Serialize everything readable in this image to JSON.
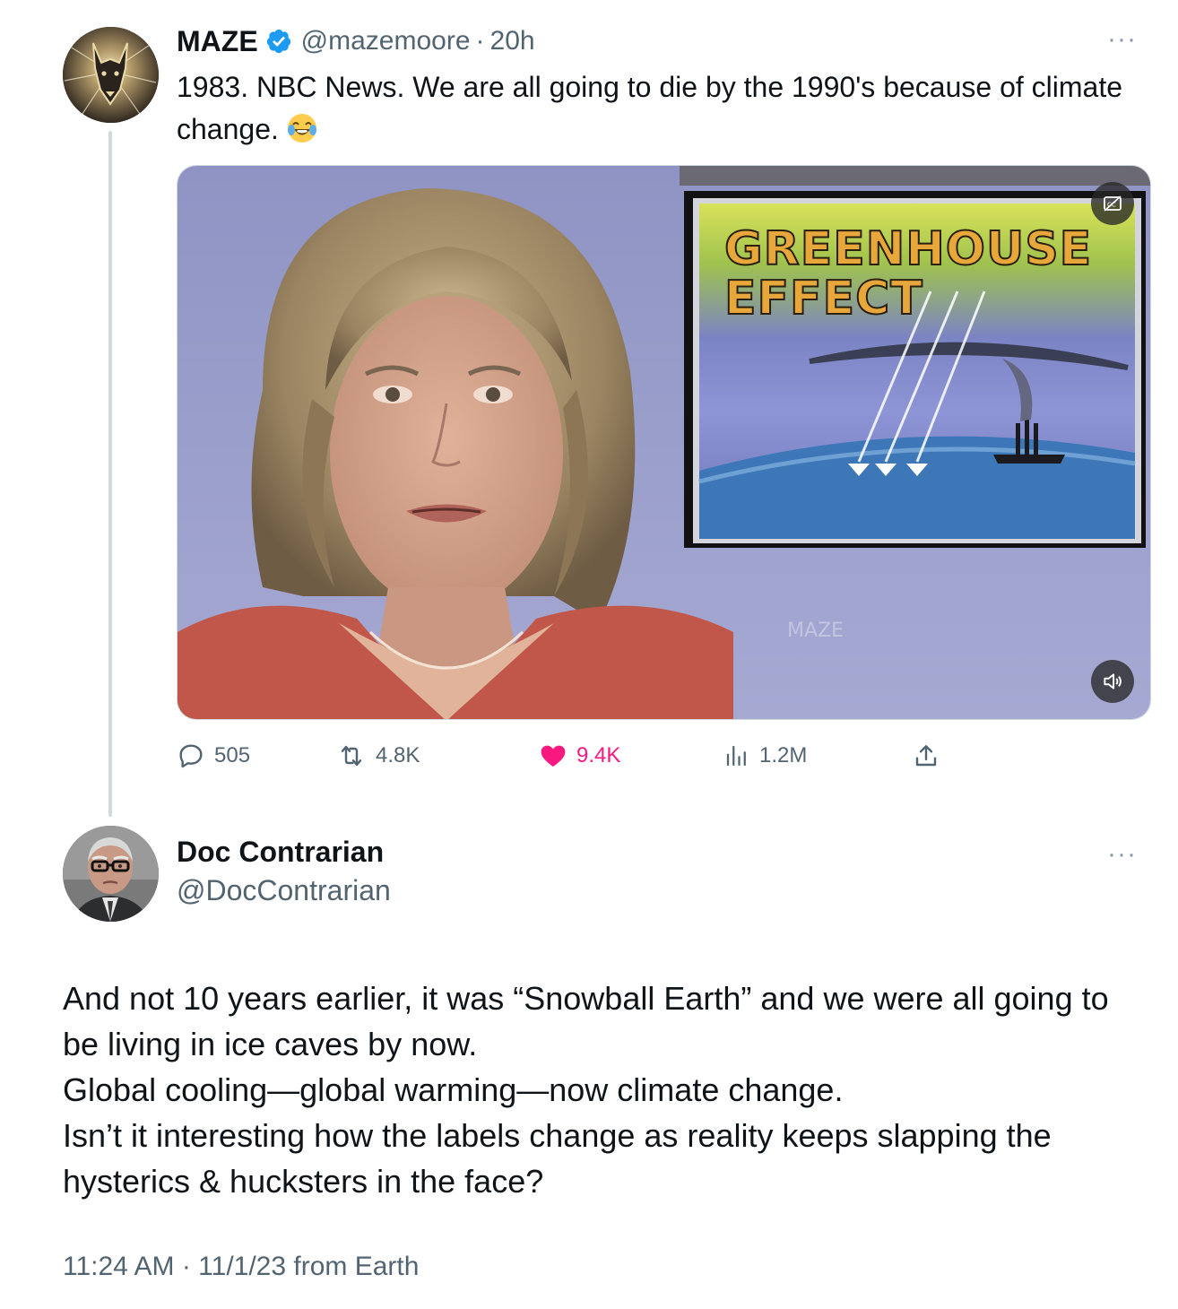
{
  "tweet": {
    "author": {
      "display_name": "MAZE",
      "handle": "@mazemoore",
      "verified": true,
      "avatar_icon": "doberman-logo-avatar"
    },
    "separator": "·",
    "time": "20h",
    "more_icon": "more-horizontal-icon",
    "more_label": "···",
    "text": "1983. NBC News. We are all going to die by the 1990's because of climate change.",
    "emoji_icon": "face-with-tears-of-joy-emoji",
    "media": {
      "type": "video",
      "overlay_title": "GREENHOUSE",
      "overlay_subtitle": "EFFECT",
      "watermark": "MAZE",
      "captions_icon": "captions-off-icon",
      "sound_icon": "speaker-icon"
    },
    "actions": {
      "replies": "505",
      "retweets": "4.8K",
      "likes": "9.4K",
      "views": "1.2M",
      "liked": true,
      "like_color": "#f91880"
    }
  },
  "reply": {
    "author": {
      "display_name": "Doc Contrarian",
      "handle": "@DocContrarian",
      "avatar_icon": "elderly-man-avatar"
    },
    "more_label": "···",
    "paragraphs": [
      "And not 10 years earlier, it was “Snowball Earth” and we were all going to be living in ice caves by now.",
      "Global cooling—global warming—now climate change.",
      "Isn’t it interesting how the labels change as reality keeps slapping the hysterics & hucksters in the face?"
    ],
    "timestamp": "11:24 AM · 11/1/23 from Earth"
  },
  "colors": {
    "text_primary": "#0f1419",
    "text_secondary": "#536471",
    "verified_blue": "#1d9bf0",
    "like_pink": "#f91880",
    "thread_line": "#cfd9de"
  }
}
